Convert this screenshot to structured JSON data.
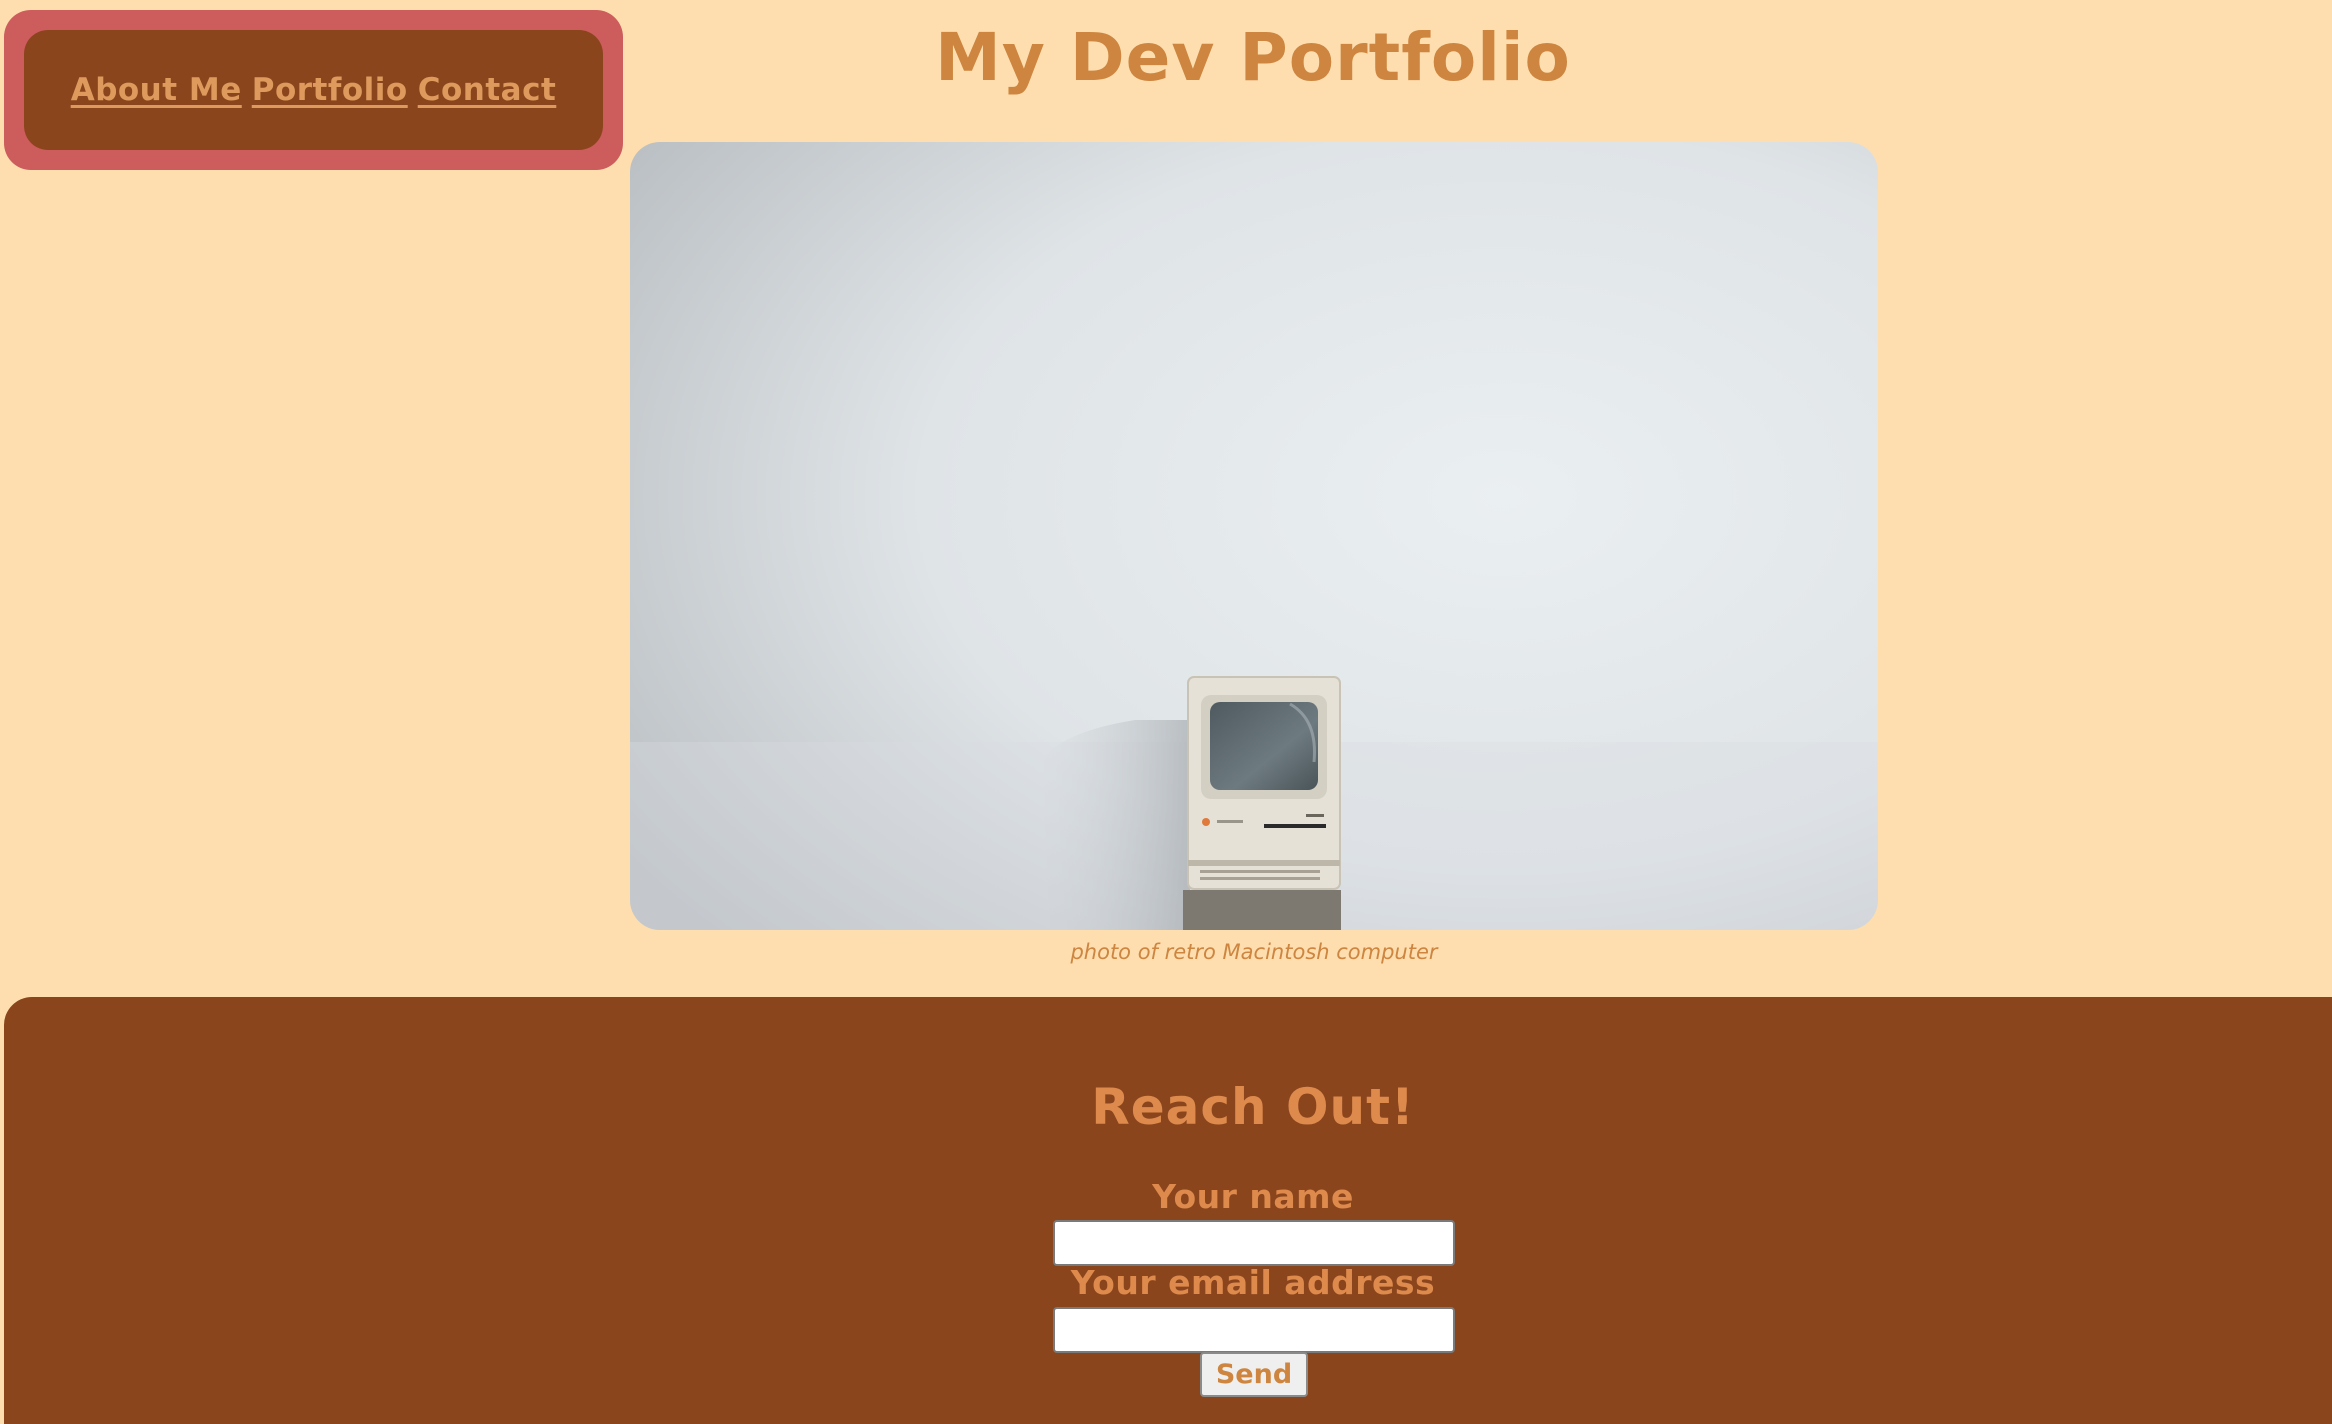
{
  "nav": {
    "links": [
      "About Me",
      "Portfolio",
      "Contact"
    ]
  },
  "header": {
    "title": "My Dev Portfolio"
  },
  "hero": {
    "caption": "photo of retro Macintosh computer"
  },
  "contact": {
    "heading": "Reach Out!",
    "name_label": "Your name",
    "name_value": "",
    "email_label": "Your email address",
    "email_value": "",
    "send_label": "Send"
  },
  "colors": {
    "background": "#fedeaf",
    "nav_border": "#cd5c5c",
    "panel": "#8b451d",
    "accent_text": "#cd853f"
  },
  "icons": {
    "hero_image": "retro-macintosh-photo"
  }
}
